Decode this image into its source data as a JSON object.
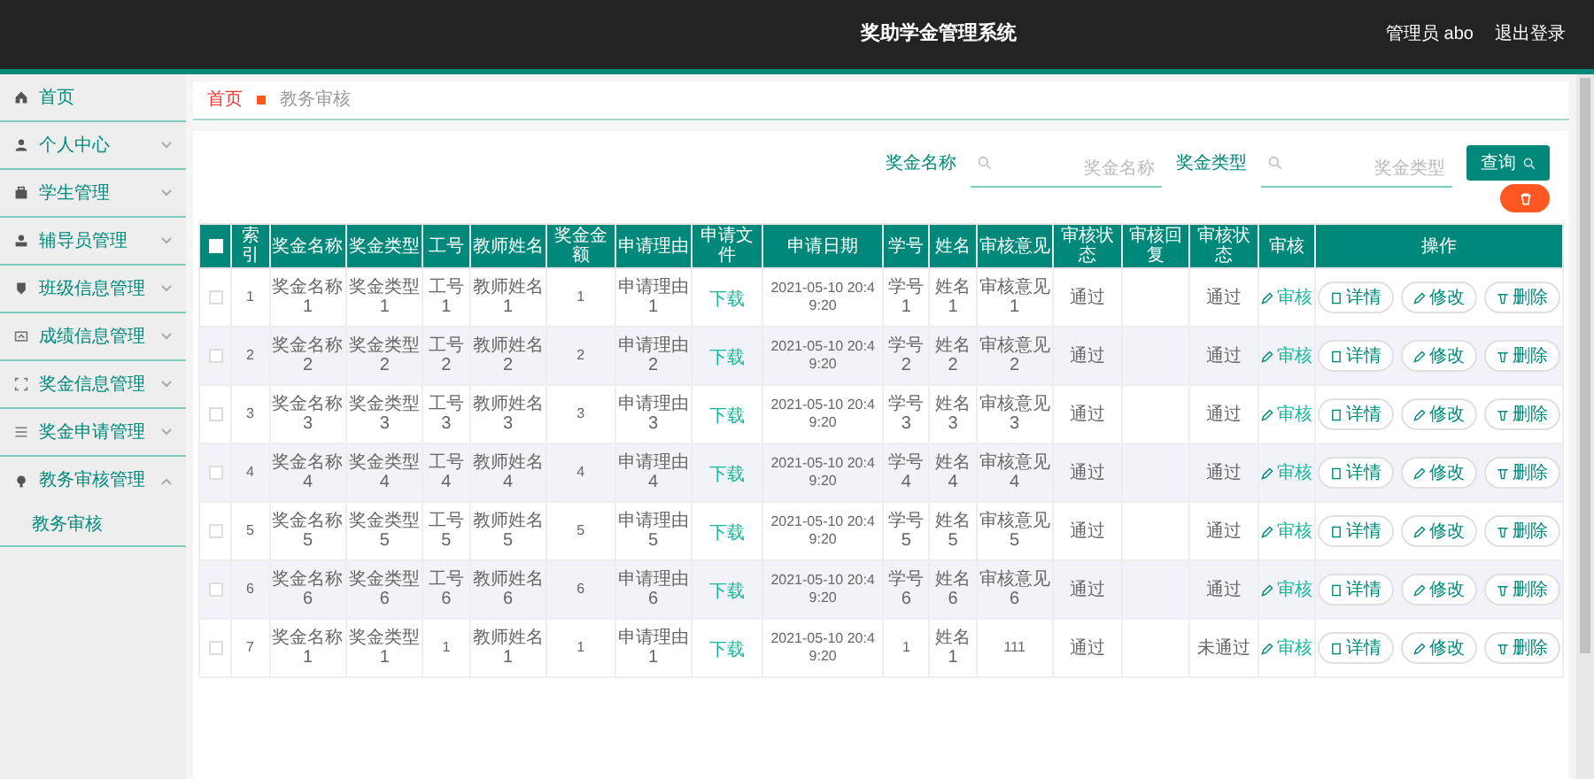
{
  "header": {
    "title": "奖助学金管理系统",
    "user": "管理员 abo",
    "logout": "退出登录"
  },
  "sidebar": {
    "items": [
      {
        "label": "首页"
      },
      {
        "label": "个人中心",
        "expanded": false
      },
      {
        "label": "学生管理",
        "expanded": false
      },
      {
        "label": "辅导员管理",
        "expanded": false
      },
      {
        "label": "班级信息管理",
        "expanded": false
      },
      {
        "label": "成绩信息管理",
        "expanded": false
      },
      {
        "label": "奖金信息管理",
        "expanded": false
      },
      {
        "label": "奖金申请管理",
        "expanded": false
      },
      {
        "label": "教务审核管理",
        "expanded": true,
        "children": [
          {
            "label": "教务审核"
          }
        ]
      }
    ]
  },
  "breadcrumb": [
    "首页",
    "教务审核"
  ],
  "search": {
    "fields": [
      {
        "label": "奖金名称",
        "placeholder": "奖金名称"
      },
      {
        "label": "奖金类型",
        "placeholder": "奖金类型"
      }
    ],
    "button": "查询"
  },
  "table": {
    "select_all": {
      "checked": false
    },
    "columns": [
      {
        "label": "索引",
        "kind": "text"
      },
      {
        "label": "奖金名称",
        "kind": "text"
      },
      {
        "label": "奖金类型",
        "kind": "text"
      },
      {
        "label": "工号",
        "kind": "text"
      },
      {
        "label": "教师姓名",
        "kind": "text"
      },
      {
        "label": "奖金金额",
        "kind": "text"
      },
      {
        "label": "申请理由",
        "kind": "text"
      },
      {
        "label": "申请文件",
        "kind": "link"
      },
      {
        "label": "申请日期",
        "kind": "text"
      },
      {
        "label": "学号",
        "kind": "text"
      },
      {
        "label": "姓名",
        "kind": "text"
      },
      {
        "label": "审核意见",
        "kind": "text"
      },
      {
        "label": "审核状态",
        "kind": "text"
      },
      {
        "label": "审核回复",
        "kind": "text"
      },
      {
        "label": "审核状态",
        "kind": "text"
      },
      {
        "label": "审核",
        "kind": "audit"
      },
      {
        "label": "操作",
        "kind": "actions"
      }
    ],
    "rows": [
      {
        "checked": false,
        "cells": [
          "1",
          "奖金名称1",
          "奖金类型1",
          "工号1",
          "教师姓名1",
          "1",
          "申请理由1",
          "下载",
          "2021-05-10 20:49:20",
          "学号1",
          "姓名1",
          "审核意见1",
          "通过",
          "",
          "通过",
          "审核",
          [
            "详情",
            "修改",
            "删除"
          ]
        ]
      },
      {
        "checked": false,
        "cells": [
          "2",
          "奖金名称2",
          "奖金类型2",
          "工号2",
          "教师姓名2",
          "2",
          "申请理由2",
          "下载",
          "2021-05-10 20:49:20",
          "学号2",
          "姓名2",
          "审核意见2",
          "通过",
          "",
          "通过",
          "审核",
          [
            "详情",
            "修改",
            "删除"
          ]
        ]
      },
      {
        "checked": false,
        "cells": [
          "3",
          "奖金名称3",
          "奖金类型3",
          "工号3",
          "教师姓名3",
          "3",
          "申请理由3",
          "下载",
          "2021-05-10 20:49:20",
          "学号3",
          "姓名3",
          "审核意见3",
          "通过",
          "",
          "通过",
          "审核",
          [
            "详情",
            "修改",
            "删除"
          ]
        ]
      },
      {
        "checked": false,
        "cells": [
          "4",
          "奖金名称4",
          "奖金类型4",
          "工号4",
          "教师姓名4",
          "4",
          "申请理由4",
          "下载",
          "2021-05-10 20:49:20",
          "学号4",
          "姓名4",
          "审核意见4",
          "通过",
          "",
          "通过",
          "审核",
          [
            "详情",
            "修改",
            "删除"
          ]
        ]
      },
      {
        "checked": false,
        "cells": [
          "5",
          "奖金名称5",
          "奖金类型5",
          "工号5",
          "教师姓名5",
          "5",
          "申请理由5",
          "下载",
          "2021-05-10 20:49:20",
          "学号5",
          "姓名5",
          "审核意见5",
          "通过",
          "",
          "通过",
          "审核",
          [
            "详情",
            "修改",
            "删除"
          ]
        ]
      },
      {
        "checked": false,
        "cells": [
          "6",
          "奖金名称6",
          "奖金类型6",
          "工号6",
          "教师姓名6",
          "6",
          "申请理由6",
          "下载",
          "2021-05-10 20:49:20",
          "学号6",
          "姓名6",
          "审核意见6",
          "通过",
          "",
          "通过",
          "审核",
          [
            "详情",
            "修改",
            "删除"
          ]
        ]
      },
      {
        "checked": false,
        "cells": [
          "7",
          "奖金名称1",
          "奖金类型1",
          "1",
          "教师姓名1",
          "1",
          "申请理由1",
          "下载",
          "2021-05-10 20:49:20",
          "1",
          "姓名1",
          "111",
          "通过",
          "",
          "未通过",
          "审核",
          [
            "详情",
            "修改",
            "删除"
          ]
        ]
      }
    ]
  }
}
